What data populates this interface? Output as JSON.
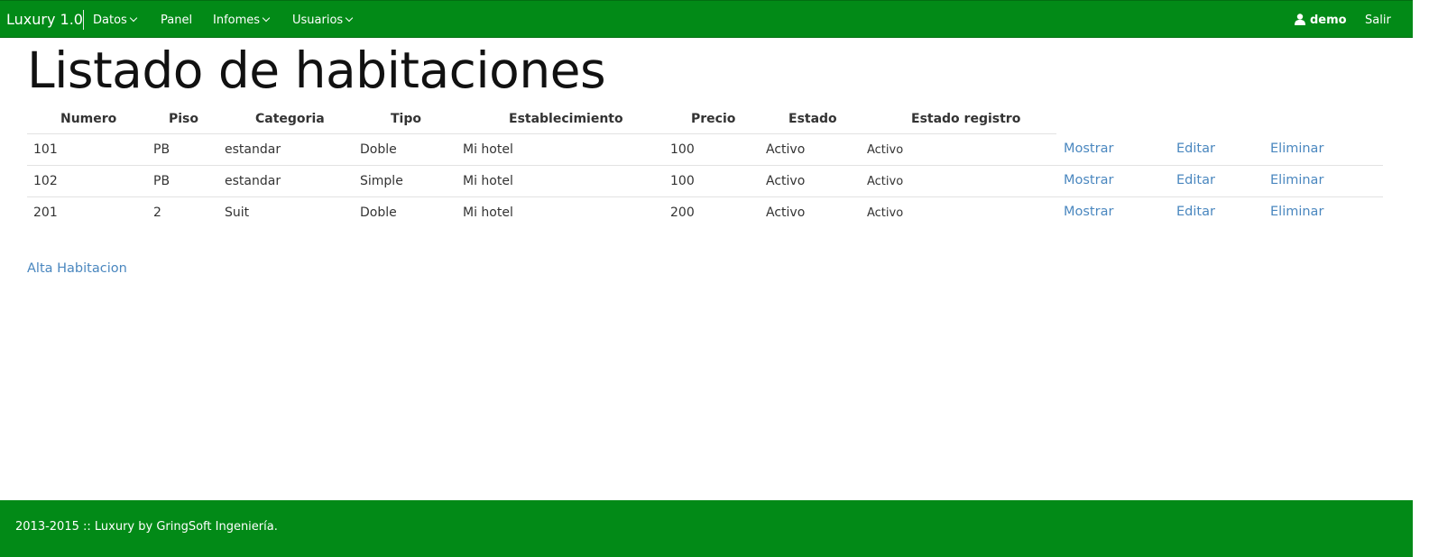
{
  "navbar": {
    "brand": "Luxury 1.0",
    "menu": [
      {
        "label": "Datos"
      },
      {
        "label": "Panel"
      },
      {
        "label": "Infomes"
      },
      {
        "label": "Usuarios"
      }
    ],
    "user": "demo",
    "logout": "Salir"
  },
  "page": {
    "title": "Listado de habitaciones"
  },
  "table": {
    "headers": [
      "Numero",
      "Piso",
      "Categoria",
      "Tipo",
      "Establecimiento",
      "Precio",
      "Estado",
      "Estado registro"
    ],
    "rows": [
      {
        "numero": "101",
        "piso": "PB",
        "categoria": "estandar",
        "tipo": "Doble",
        "establecimiento": "Mi hotel",
        "precio": "100",
        "estado": "Activo",
        "estado_registro": "Activo"
      },
      {
        "numero": "102",
        "piso": "PB",
        "categoria": "estandar",
        "tipo": "Simple",
        "establecimiento": "Mi hotel",
        "precio": "100",
        "estado": "Activo",
        "estado_registro": "Activo"
      },
      {
        "numero": "201",
        "piso": "2",
        "categoria": "Suit",
        "tipo": "Doble",
        "establecimiento": "Mi hotel",
        "precio": "200",
        "estado": "Activo",
        "estado_registro": "Activo"
      }
    ],
    "actions": {
      "show": "Mostrar",
      "edit": "Editar",
      "delete": "Eliminar"
    }
  },
  "add_link": "Alta Habitacion",
  "footer": {
    "text": "2013-2015 :: Luxury by GringSoft Ingeniería."
  },
  "colors": {
    "navbar_bg": "#028a17",
    "link": "#4a87bf"
  },
  "icons": {
    "user": "user-icon",
    "dropdown": "chevron-down-icon"
  }
}
